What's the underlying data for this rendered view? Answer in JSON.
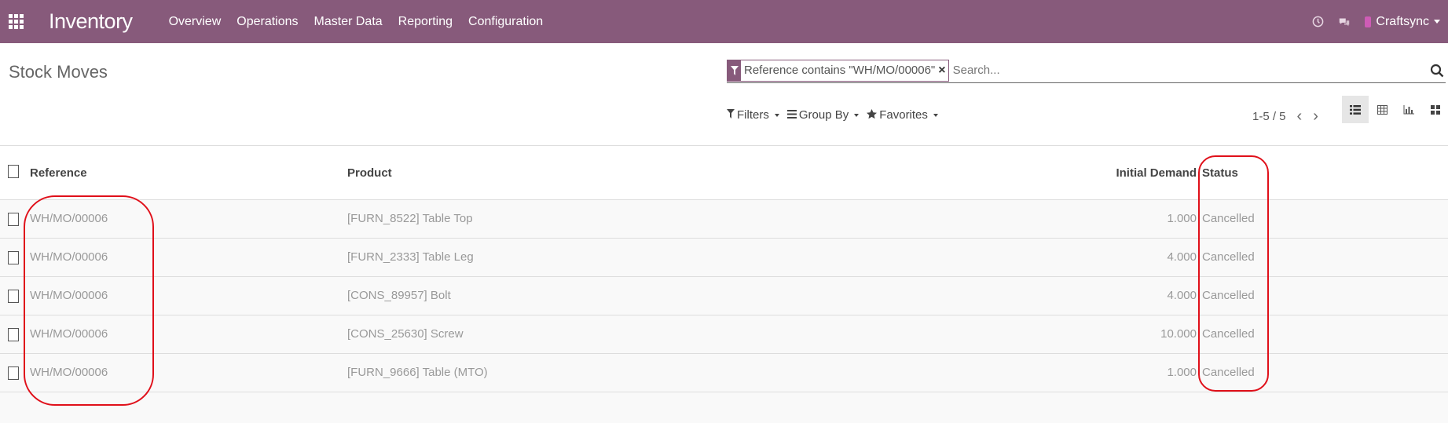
{
  "app": {
    "name": "Inventory",
    "menu": [
      "Overview",
      "Operations",
      "Master Data",
      "Reporting",
      "Configuration"
    ],
    "user": "Craftsync",
    "icons": [
      "apps-grid-icon",
      "clock-icon",
      "chat-icon"
    ]
  },
  "control": {
    "title": "Stock Moves",
    "facet": "Reference contains \"WH/MO/00006\"",
    "search_placeholder": "Search...",
    "filters_label": "Filters",
    "groupby_label": "Group By",
    "favorites_label": "Favorites",
    "pager": "1-5 / 5"
  },
  "table": {
    "headers": {
      "reference": "Reference",
      "product": "Product",
      "initial_demand": "Initial Demand",
      "status": "Status"
    },
    "rows": [
      {
        "reference": "WH/MO/00006",
        "product": "[FURN_8522] Table Top",
        "initial_demand": "1.000",
        "status": "Cancelled"
      },
      {
        "reference": "WH/MO/00006",
        "product": "[FURN_2333] Table Leg",
        "initial_demand": "4.000",
        "status": "Cancelled"
      },
      {
        "reference": "WH/MO/00006",
        "product": "[CONS_89957] Bolt",
        "initial_demand": "4.000",
        "status": "Cancelled"
      },
      {
        "reference": "WH/MO/00006",
        "product": "[CONS_25630] Screw",
        "initial_demand": "10.000",
        "status": "Cancelled"
      },
      {
        "reference": "WH/MO/00006",
        "product": "[FURN_9666] Table (MTO)",
        "initial_demand": "1.000",
        "status": "Cancelled"
      }
    ]
  },
  "colors": {
    "navbar": "#875a7b",
    "highlight": "#e0101a"
  }
}
